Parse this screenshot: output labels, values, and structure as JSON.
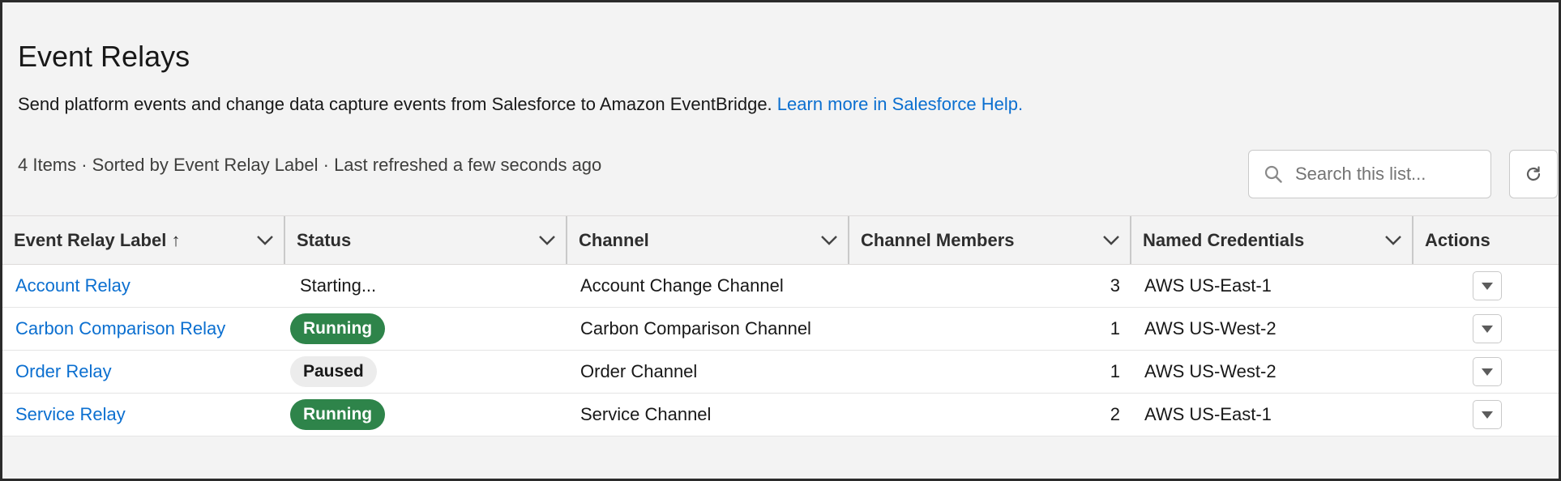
{
  "header": {
    "title": "Event Relays",
    "description": "Send platform events and change data capture events from Salesforce to Amazon EventBridge.",
    "help_link": "Learn more in Salesforce Help.",
    "meta": "4 Items · Sorted by Event Relay Label · Last refreshed a few seconds ago"
  },
  "search": {
    "placeholder": "Search this list..."
  },
  "icons": {
    "search": "search-icon",
    "refresh": "refresh-icon",
    "sort_ascending": "arrow-up-icon",
    "column_menu": "chevron-down-icon",
    "row_action": "down-triangle-icon"
  },
  "colors": {
    "link": "#0b6fd0",
    "running_badge": "#2e844a",
    "paused_badge": "#ececec",
    "background": "#f3f3f3"
  },
  "table": {
    "columns": [
      "Event Relay Label",
      "Status",
      "Channel",
      "Channel Members",
      "Named Credentials",
      "Actions"
    ],
    "sort_indicator": "↑",
    "rows": [
      {
        "label": "Account Relay",
        "status": "Starting...",
        "channel": "Account Change Channel",
        "members": "3",
        "credentials": "AWS US-East-1"
      },
      {
        "label": "Carbon Comparison Relay",
        "status": "Running",
        "channel": "Carbon Comparison Channel",
        "members": "1",
        "credentials": "AWS US-West-2"
      },
      {
        "label": "Order Relay",
        "status": "Paused",
        "channel": "Order Channel",
        "members": "1",
        "credentials": "AWS US-West-2"
      },
      {
        "label": "Service Relay",
        "status": "Running",
        "channel": "Service Channel",
        "members": "2",
        "credentials": "AWS US-East-1"
      }
    ]
  }
}
